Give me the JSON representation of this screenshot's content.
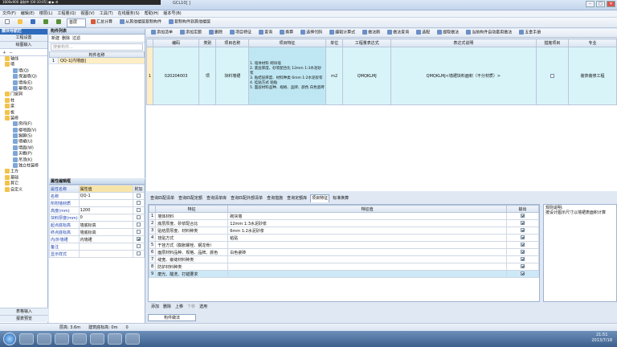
{
  "window": {
    "capture_bar": "1600x900   录制中  [00:10:05]   ◼  ▶  ⚙",
    "title": "GCL10[ ]",
    "min": "–",
    "max": "□",
    "close": "✕"
  },
  "menu": [
    "文件(F)",
    "编辑(E)",
    "楼层(L)",
    "工程量(Q)",
    "视图(V)",
    "工具(T)",
    "在线服务(S)",
    "帮助(H)",
    "版本号(B)"
  ],
  "toolbar": {
    "items": [
      "新建",
      "打开",
      "保存",
      "撤销",
      "恢复"
    ],
    "floor_select": "首层",
    "calc": "汇总计算",
    "copy_floor": "从其他楼层复制构件",
    "copy_to": "复制构件到其他楼层"
  },
  "left_panel": {
    "title": "模块导航栏",
    "section": "工程设置",
    "subsection": "绘图输入",
    "tree": [
      "轴线",
      "墙",
      "墙(Q)",
      "保温墙(Q)",
      "墙垛(E)",
      "幕墙(Q)",
      "门窗洞",
      "柱",
      "梁",
      "板",
      "装修",
      "房间(F)",
      "楼地面(V)",
      "踢脚(S)",
      "墙裙(U)",
      "墙面(W)",
      "天棚(P)",
      "吊顶(K)",
      "独立柱装修",
      "土方",
      "基础",
      "其它",
      "自定义"
    ],
    "footer1": "表格输入",
    "footer2": "报表预览"
  },
  "component_list": {
    "title": "构件列表",
    "tools": [
      "新建",
      "删除",
      "过滤"
    ],
    "search_placeholder": "搜索构件...",
    "col": "构件名称",
    "rows": [
      {
        "no": "1",
        "name": "QQ-1[内墙面]"
      }
    ]
  },
  "properties": {
    "title": "属性编辑框",
    "headers": [
      "属性名称",
      "属性值",
      "附加"
    ],
    "rows": [
      {
        "name": "名称",
        "value": "QQ-1",
        "checked": false
      },
      {
        "name": "所附墙材质",
        "value": "",
        "checked": false
      },
      {
        "name": "高度(mm)",
        "value": "1200",
        "checked": false
      },
      {
        "name": "块料厚度(mm)",
        "value": "0",
        "checked": false
      },
      {
        "name": "起点底标高",
        "value": "墙底标高",
        "checked": false
      },
      {
        "name": "终点底标高",
        "value": "墙底标高",
        "checked": false
      },
      {
        "name": "内/外墙裙",
        "value": "内墙裙",
        "checked": true
      },
      {
        "name": "备注",
        "value": "",
        "checked": false
      },
      {
        "name": "显示样式",
        "value": "",
        "checked": false
      }
    ]
  },
  "right_toolbar": [
    "添加清单",
    "添加定额",
    "删除",
    "项目特征",
    "查询",
    "换算",
    "选择代码",
    "编辑计算式",
    "做法刷",
    "做法查询",
    "选配",
    "提取做法",
    "当前构件自动套用做法",
    "五金手册"
  ],
  "grid": {
    "headers": [
      "",
      "编码",
      "类别",
      "项目名称",
      "项目特征",
      "单位",
      "工程量表达式",
      "表达式说明",
      "措施项目",
      "专业"
    ],
    "row": {
      "no": "1",
      "code": "020204003",
      "type": "项",
      "name": "块料墙裙",
      "features": "1. 墙体材料 砌块墙\n2. 底层厚度、砂浆配合比 12mm 1:3水泥砂浆\n3. 贴结层厚度、材料种类 6mm 1:2水泥砂浆\n4. 挂贴方式 粘贴\n5. 面层材料品种、规格、品牌、颜色 白色瓷砖",
      "unit": "m2",
      "expr": "QMQKLMJ",
      "expr_desc": "QMQKLMJ<墙裙块料面积（不分材质）>",
      "measure": false,
      "major": "装饰装修工程"
    }
  },
  "tabs": [
    "查询匹配清单",
    "查询匹配定额",
    "查询清单库",
    "查询匹配外部清单",
    "查询措施",
    "查询定额库",
    "项目特征",
    "标准换算"
  ],
  "active_tab": "项目特征",
  "features": {
    "headers": [
      "",
      "特征",
      "特征值",
      "输出"
    ],
    "rows": [
      {
        "no": "1",
        "feature": "墙体材料",
        "value": "砌块墙",
        "out": true
      },
      {
        "no": "2",
        "feature": "底层厚度、砂浆配合比",
        "value": "12mm 1:3水泥砂浆",
        "out": true
      },
      {
        "no": "3",
        "feature": "贴结层厚度、材料种类",
        "value": "6mm 1:2水泥砂浆",
        "out": true
      },
      {
        "no": "4",
        "feature": "挂贴方式",
        "value": "粘贴",
        "out": true
      },
      {
        "no": "5",
        "feature": "干挂方式（膨胀螺栓、钢龙骨）",
        "value": "",
        "out": true
      },
      {
        "no": "6",
        "feature": "面层材料品种、规格、品牌、颜色",
        "value": "白色瓷砖",
        "out": true
      },
      {
        "no": "7",
        "feature": "缝宽、嵌缝材料种类",
        "value": "",
        "out": true
      },
      {
        "no": "8",
        "feature": "防护材料种类",
        "value": "",
        "out": true
      },
      {
        "no": "9",
        "feature": "磨光、酸洗、打蜡要求",
        "value": "",
        "out": true
      }
    ]
  },
  "notes": {
    "title": "规则说明:",
    "text": "按设计图示尺寸以墙裙表面积计算"
  },
  "bottom_tools": [
    "添加",
    "删除",
    "上移",
    "下移",
    "选用"
  ],
  "bottom_tab": "构件做法",
  "status": {
    "floor_height": "层高: 3.6m",
    "base_elev": "建筑底标高: 0m",
    "extra": "0"
  },
  "clock": {
    "time": "21:51",
    "date": "2013/7/18"
  }
}
